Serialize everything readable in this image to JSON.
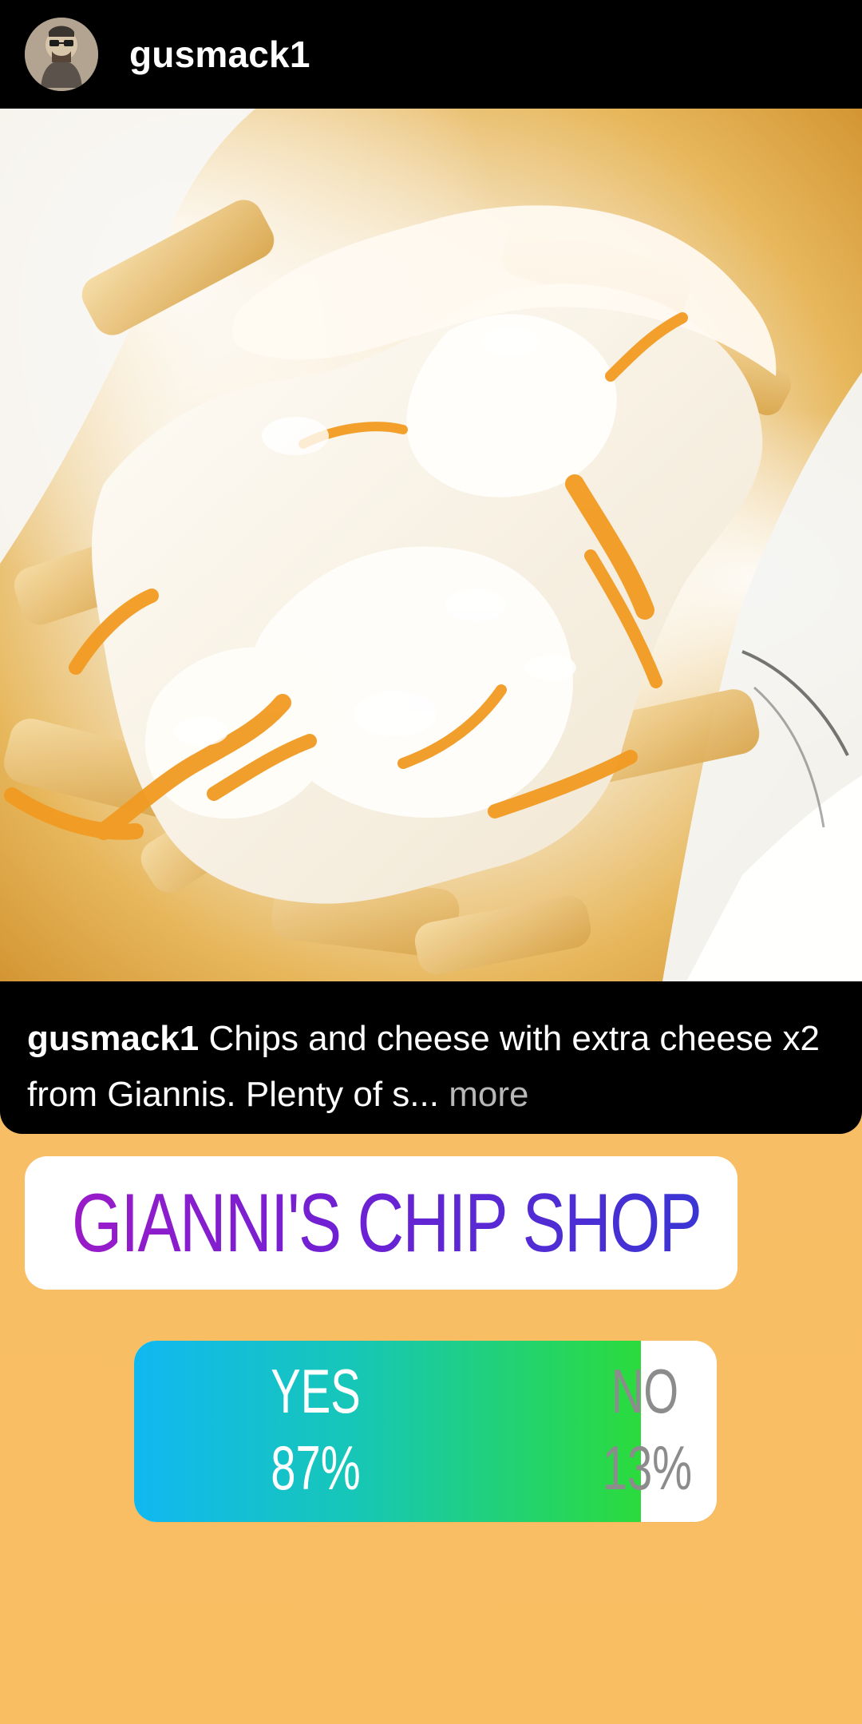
{
  "header": {
    "username": "gusmack1",
    "avatar_icon": "profile-avatar"
  },
  "photo": {
    "subject": "cheese fries"
  },
  "caption": {
    "username": "gusmack1",
    "text": " Chips and cheese with extra cheese x2 from Giannis. Plenty of s",
    "ellipsis": "...",
    "more_label": " more"
  },
  "location_sticker": {
    "icon": "location-pin-icon",
    "label": "GIANNI'S CHIP SHOP",
    "colors": {
      "start": "#9a1bc8",
      "end": "#3a35d4"
    }
  },
  "poll": {
    "yes": {
      "label": "YES",
      "percent_text": "87%",
      "percent": 87
    },
    "no": {
      "label": "NO",
      "percent_text": "13%",
      "percent": 13
    },
    "colors": {
      "fill_start": "#10b8f1",
      "fill_end": "#2bdb3c",
      "background": "#ffffff"
    }
  }
}
